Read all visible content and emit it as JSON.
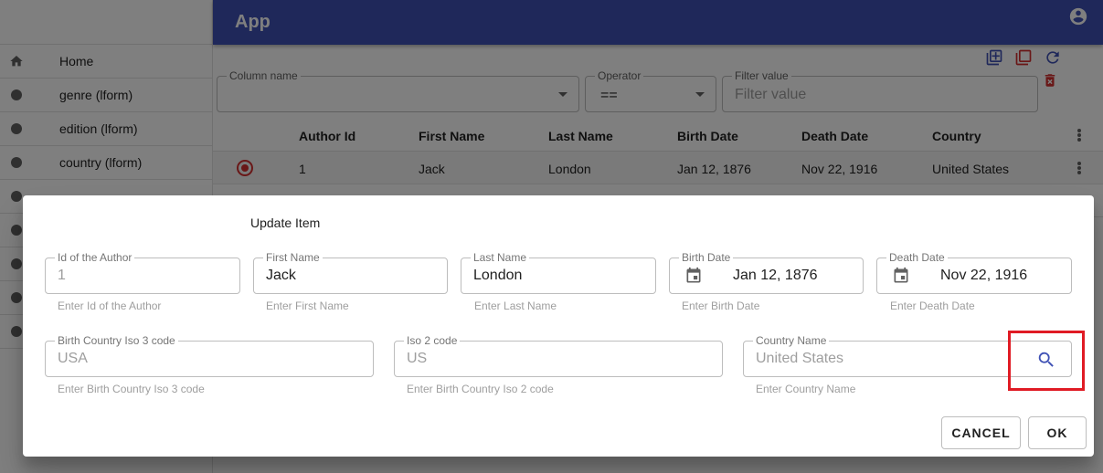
{
  "app": {
    "title": "App"
  },
  "sidebar": {
    "items": [
      {
        "label": "Home",
        "icon": "home-icon"
      },
      {
        "label": "genre (lform)",
        "icon": "circle-icon"
      },
      {
        "label": "edition (lform)",
        "icon": "circle-icon"
      },
      {
        "label": "country (lform)",
        "icon": "circle-icon"
      },
      {
        "label": "",
        "icon": "circle-icon"
      },
      {
        "label": "",
        "icon": "circle-icon"
      },
      {
        "label": "",
        "icon": "circle-icon"
      },
      {
        "label": "",
        "icon": "circle-icon"
      },
      {
        "label": "",
        "icon": "circle-icon"
      }
    ]
  },
  "filter": {
    "column_label": "Column name",
    "operator_label": "Operator",
    "operator_value": "==",
    "value_label": "Filter value",
    "value_placeholder": "Filter value"
  },
  "table": {
    "headers": [
      "Author Id",
      "First Name",
      "Last Name",
      "Birth Date",
      "Death Date",
      "Country"
    ],
    "rows": [
      [
        "1",
        "Jack",
        "London",
        "Jan 12, 1876",
        "Nov 22, 1916",
        "United States"
      ]
    ]
  },
  "dialog": {
    "title": "Update Item",
    "fields": {
      "id": {
        "label": "Id of the Author",
        "value": "1",
        "helper": "Enter Id of the Author"
      },
      "first_name": {
        "label": "First Name",
        "value": "Jack",
        "helper": "Enter First Name"
      },
      "last_name": {
        "label": "Last Name",
        "value": "London",
        "helper": "Enter Last Name"
      },
      "birth_date": {
        "label": "Birth Date",
        "value": "Jan 12, 1876",
        "helper": "Enter Birth Date"
      },
      "death_date": {
        "label": "Death Date",
        "value": "Nov 22, 1916",
        "helper": "Enter Death Date"
      },
      "iso3": {
        "label": "Birth Country Iso 3 code",
        "value": "USA",
        "helper": "Enter Birth Country Iso 3 code"
      },
      "iso2": {
        "label": "Iso 2 code",
        "value": "US",
        "helper": "Enter Birth Country Iso 2 code"
      },
      "country_name": {
        "label": "Country Name",
        "value": "United States",
        "helper": "Enter Country Name"
      }
    },
    "cancel_label": "CANCEL",
    "ok_label": "OK"
  },
  "colors": {
    "primary": "#3f51b5",
    "accent": "#d32f2f",
    "highlight": "#e01b24"
  }
}
